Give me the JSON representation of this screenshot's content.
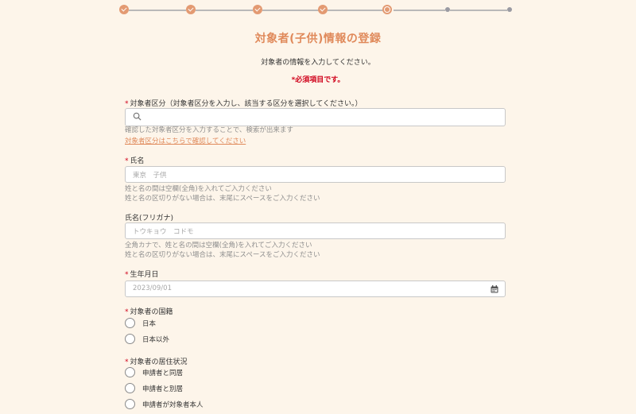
{
  "colors": {
    "accent": "#e08a5b",
    "required": "#d0021b",
    "background": "#fdf5ea"
  },
  "progress": {
    "total_steps": 7,
    "completed_steps": 4,
    "current_step": 5
  },
  "header": {
    "title": "対象者(子供)情報の登録",
    "subtitle": "対象者の情報を入力してください。",
    "required_note": "*必須項目です。"
  },
  "form": {
    "category": {
      "star": "*",
      "label": "対象者区分（対象者区分を入力し、該当する区分を選択してください。）",
      "icon": "search-icon",
      "value": "",
      "hint": "確認した対象者区分を入力することで、検索が出来ます",
      "link": "対象者区分はこちらで確認してください"
    },
    "name": {
      "star": "*",
      "label": "氏名",
      "placeholder": "東京　子供",
      "hint1": "姓と名の間は空欄(全角)を入れてご入力ください",
      "hint2": "姓と名の区切りがない場合は、末尾にスペースをご入力ください"
    },
    "kana": {
      "label": "氏名(フリガナ)",
      "placeholder": "トウキョウ　コドモ",
      "hint1": "全角カナで、姓と名の間は空欄(全角)を入れてご入力ください",
      "hint2": "姓と名の区切りがない場合は、末尾にスペースをご入力ください"
    },
    "birthdate": {
      "star": "*",
      "label": "生年月日",
      "placeholder": "2023/09/01",
      "icon": "calendar-icon"
    },
    "nationality": {
      "star": "*",
      "label": "対象者の国籍",
      "options": [
        "日本",
        "日本以外"
      ]
    },
    "residence": {
      "star": "*",
      "label": "対象者の居住状況",
      "options": [
        "申請者と同居",
        "申請者と別居",
        "申請者が対象者本人"
      ]
    }
  }
}
